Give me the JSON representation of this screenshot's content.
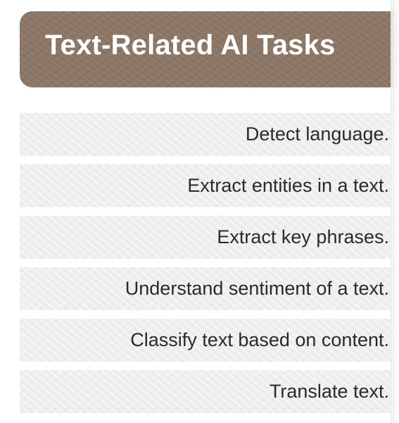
{
  "header": {
    "title": "Text-Related AI Tasks"
  },
  "tasks": [
    {
      "label": "Detect language."
    },
    {
      "label": "Extract entities in a text."
    },
    {
      "label": "Extract key phrases."
    },
    {
      "label": "Understand sentiment of a text."
    },
    {
      "label": "Classify text based on content."
    },
    {
      "label": "Translate text."
    }
  ],
  "colors": {
    "header_bg": "#8c7766",
    "header_text": "#ffffff",
    "row_bg": "#eeeeee",
    "row_text": "#2a2a2a"
  }
}
